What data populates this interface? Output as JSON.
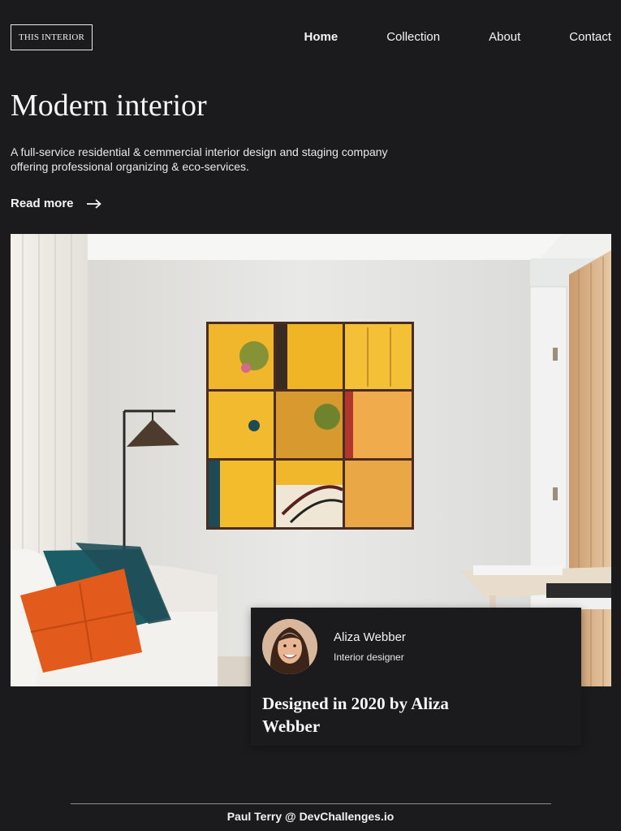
{
  "header": {
    "logo_text": "THIS INTERIOR",
    "nav": [
      {
        "label": "Home",
        "active": true
      },
      {
        "label": "Collection",
        "active": false
      },
      {
        "label": "About",
        "active": false
      },
      {
        "label": "Contact",
        "active": false
      }
    ]
  },
  "hero": {
    "title": "Modern interior",
    "description": "A full-service residential & cemmercial interior design and staging company offering professional organizing & eco-services.",
    "read_more_label": "Read more",
    "read_more_icon": "arrow-right-icon"
  },
  "photo": {
    "subject": "living-room-with-yellow-art"
  },
  "designer_card": {
    "name": "Aliza Webber",
    "role": "Interior designer",
    "credit": "Designed in 2020 by Aliza Webber"
  },
  "footer": {
    "text": "Paul Terry @ DevChallenges.io"
  },
  "colors": {
    "background": "#1b1b1d",
    "text": "#f2f2f2",
    "art_yellow": "#f2b92a",
    "pillow_orange": "#e15a1c",
    "pillow_teal": "#1b5c66"
  }
}
